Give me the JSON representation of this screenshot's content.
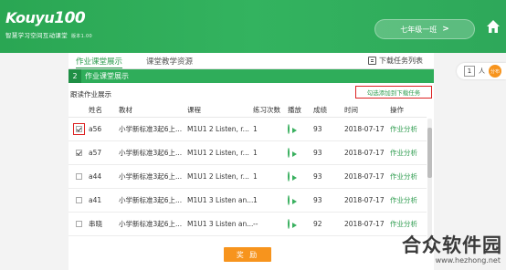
{
  "header": {
    "logo_text": "Kouyu",
    "logo_num": "100",
    "subtitle": "智慧学习空间互动课堂",
    "version": "版本1.00",
    "class_name": "七年级一班",
    "class_chevron": ">"
  },
  "tabs": [
    {
      "label": "作业课堂展示",
      "active": true
    },
    {
      "label": "课堂教学资源",
      "active": false
    }
  ],
  "download_list_label": "下载任务列表",
  "section": {
    "number": "2",
    "title": "作业课堂展示"
  },
  "reading_label": "跟读作业展示",
  "add_to_download_label": "勾选添加到下载任务",
  "table": {
    "headers": [
      "姓名",
      "教材",
      "课程",
      "练习次数",
      "播放",
      "成绩",
      "时间",
      "操作"
    ],
    "rows": [
      {
        "checked": true,
        "highlighted": true,
        "name": "a56",
        "book": "小学新标准3起6上...",
        "course": "M1U1 2 Listen, r...",
        "count": "1",
        "score": "93",
        "time": "2018-07-17",
        "action": "作业分析"
      },
      {
        "checked": true,
        "highlighted": false,
        "name": "a57",
        "book": "小学新标准3起6上...",
        "course": "M1U1 2 Listen, r...",
        "count": "1",
        "score": "93",
        "time": "2018-07-17",
        "action": "作业分析"
      },
      {
        "checked": false,
        "highlighted": false,
        "name": "a44",
        "book": "小学新标准3起6上...",
        "course": "M1U1 2 Listen, r...",
        "count": "1",
        "score": "93",
        "time": "2018-07-17",
        "action": "作业分析"
      },
      {
        "checked": false,
        "highlighted": false,
        "name": "a41",
        "book": "小学新标准3起6上...",
        "course": "M1U1 3 Listen an...",
        "count": "1",
        "score": "93",
        "time": "2018-07-17",
        "action": "作业分析"
      },
      {
        "checked": false,
        "highlighted": false,
        "name": "串晓",
        "book": "小学新标准3起6上...",
        "course": "M1U1 3 Listen an...",
        "count": "--",
        "score": "92",
        "time": "2018-07-17",
        "action": "作业分析"
      }
    ]
  },
  "submit_label": "奖 励",
  "pager": {
    "value": "1",
    "unit": "人",
    "button": "分布"
  },
  "watermark": {
    "title": "合众软件园",
    "url": "www.hezhong.net"
  },
  "colors": {
    "primary_green": "#2fad5a",
    "accent_orange": "#f7941d",
    "highlight_red": "#d22222"
  }
}
